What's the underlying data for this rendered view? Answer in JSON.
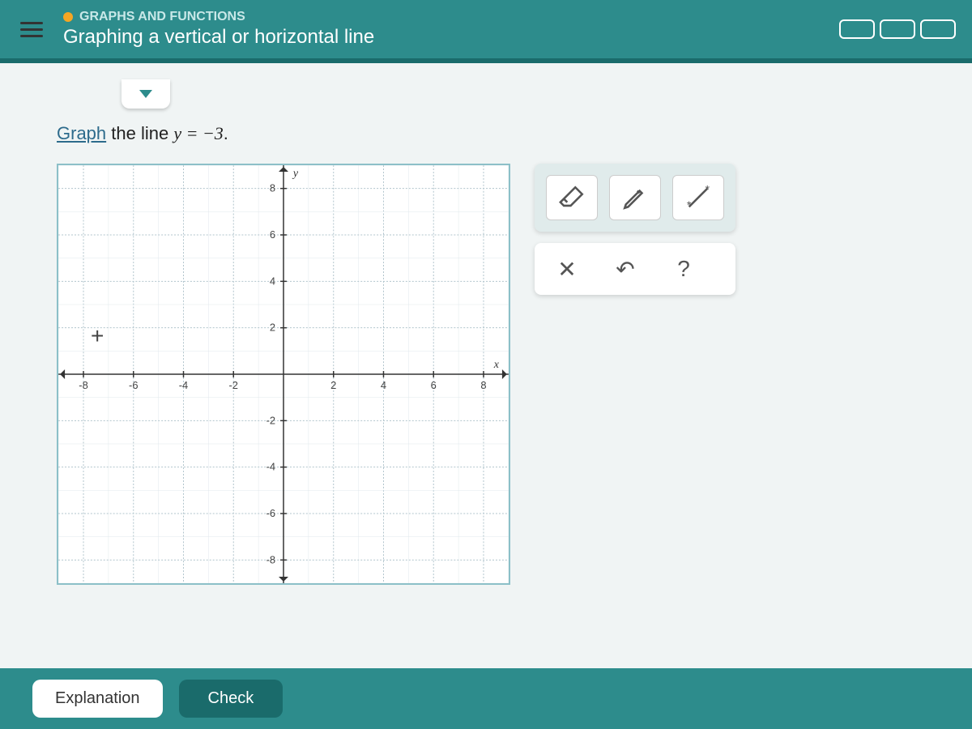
{
  "header": {
    "category": "GRAPHS AND FUNCTIONS",
    "title": "Graphing a vertical or horizontal line"
  },
  "problem": {
    "action_word": "Graph",
    "middle": " the line ",
    "equation": "y = −3",
    "end": "."
  },
  "chart_data": {
    "type": "scatter",
    "title": "",
    "xlabel": "x",
    "ylabel": "y",
    "xlim": [
      -9,
      9
    ],
    "ylim": [
      -9,
      9
    ],
    "x_ticks": [
      -8,
      -6,
      -4,
      -2,
      2,
      4,
      6,
      8
    ],
    "y_ticks": [
      -8,
      -6,
      -4,
      -2,
      2,
      4,
      6,
      8
    ],
    "series": []
  },
  "tools": {
    "eraser": "eraser",
    "pencil": "pencil",
    "line": "line",
    "clear": "✕",
    "undo": "↶",
    "help": "?"
  },
  "footer": {
    "explanation": "Explanation",
    "check": "Check"
  }
}
